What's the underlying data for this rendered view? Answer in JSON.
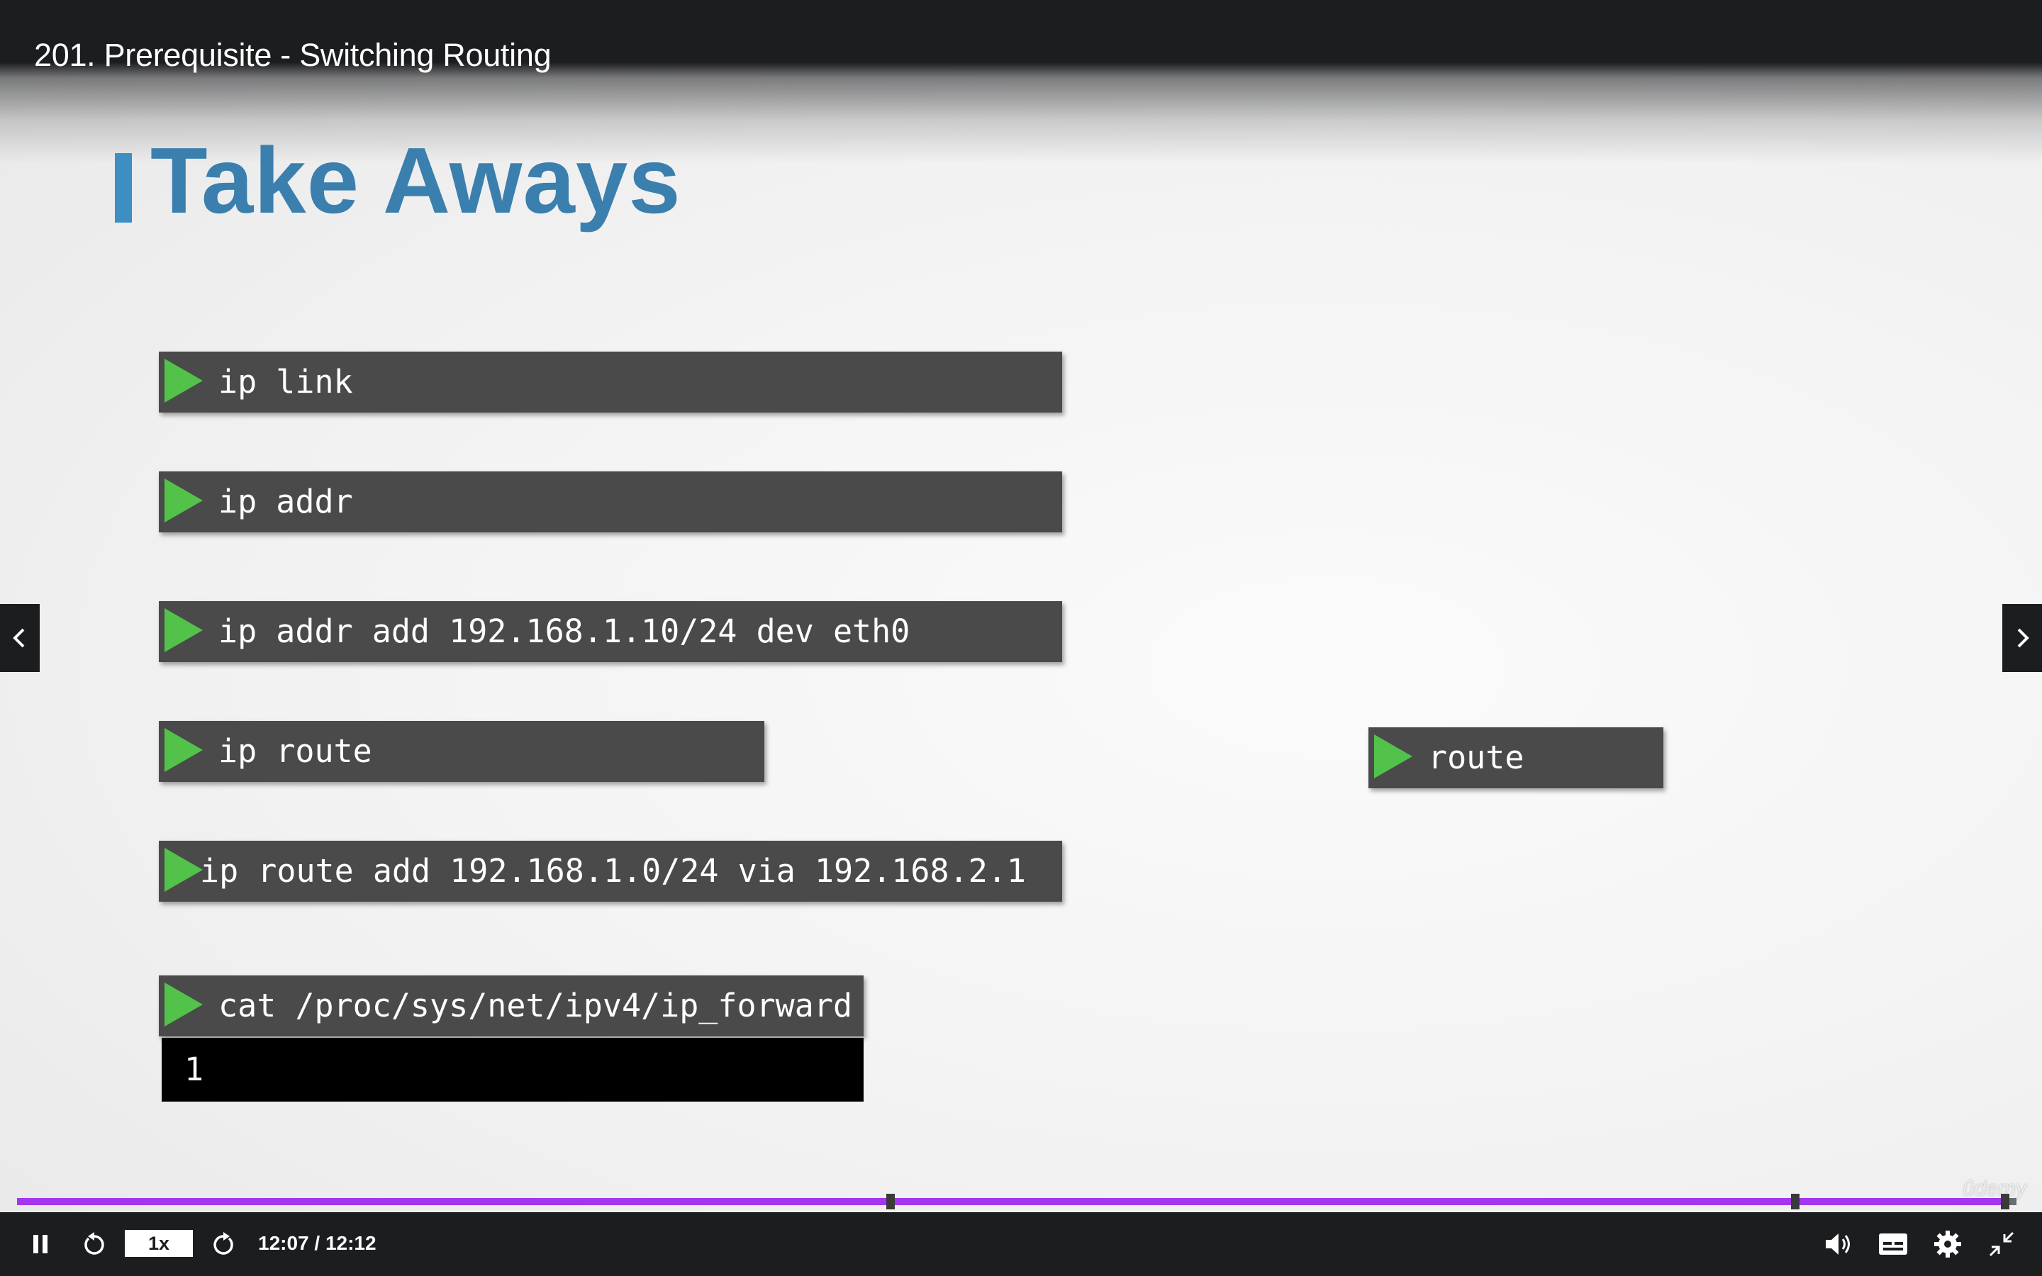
{
  "lecture": {
    "title": "201. Prerequisite - Switching Routing"
  },
  "slide": {
    "title": "Take Aways",
    "commands": [
      "ip link",
      "ip addr",
      "ip addr add 192.168.1.10/24 dev eth0",
      "ip route",
      "ip route add 192.168.1.0/24 via 192.168.2.1",
      "cat /proc/sys/net/ipv4/ip_forward"
    ],
    "side_command": "route",
    "output": "1"
  },
  "watermark": "ûdemy",
  "player": {
    "speed": "1x",
    "time": "12:07 / 12:12",
    "progress": 0.9932,
    "colors": {
      "progress": "#a435f0",
      "slide_title": "#3a7fae",
      "play_triangle": "#52c24a"
    },
    "icons": [
      "pause-icon",
      "rewind-icon",
      "forward-icon",
      "volume-icon",
      "captions-icon",
      "settings-icon",
      "exit-fullscreen-icon",
      "chevron-left-icon",
      "chevron-right-icon"
    ]
  }
}
